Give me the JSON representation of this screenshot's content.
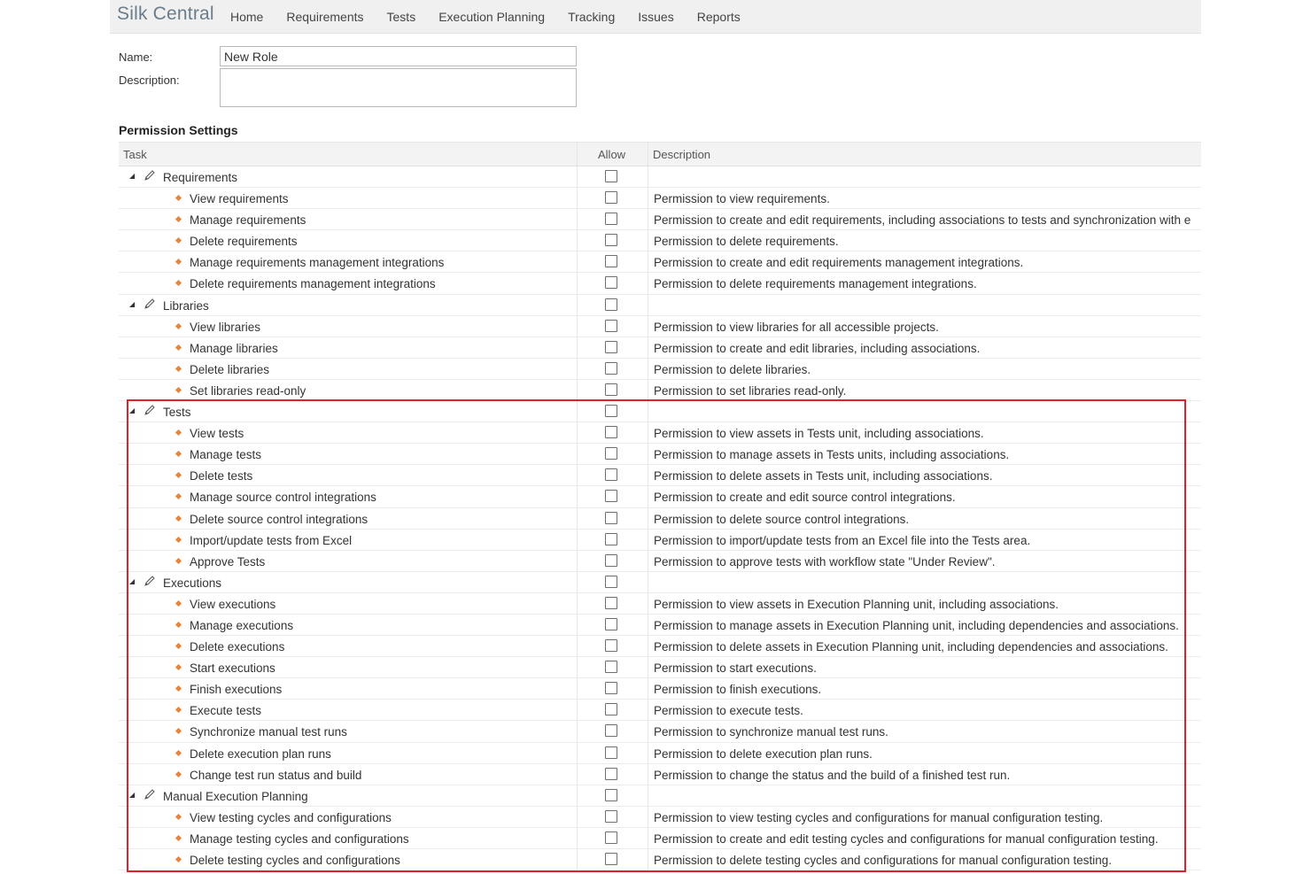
{
  "app": {
    "brand": "Silk Central",
    "nav": [
      "Home",
      "Requirements",
      "Tests",
      "Execution Planning",
      "Tracking",
      "Issues",
      "Reports"
    ]
  },
  "form": {
    "name_label": "Name:",
    "name_value": "New Role",
    "description_label": "Description:",
    "description_value": ""
  },
  "permissions": {
    "title": "Permission Settings",
    "columns": {
      "task": "Task",
      "allow": "Allow",
      "description": "Description"
    },
    "rows": [
      {
        "type": "group",
        "task": "Requirements",
        "desc": ""
      },
      {
        "type": "item",
        "task": "View requirements",
        "desc": "Permission to view requirements."
      },
      {
        "type": "item",
        "task": "Manage requirements",
        "desc": "Permission to create and edit requirements, including associations to tests and synchronization with e"
      },
      {
        "type": "item",
        "task": "Delete requirements",
        "desc": "Permission to delete requirements."
      },
      {
        "type": "item",
        "task": "Manage requirements management integrations",
        "desc": "Permission to create and edit requirements management integrations."
      },
      {
        "type": "item",
        "task": "Delete requirements management integrations",
        "desc": "Permission to delete requirements management integrations."
      },
      {
        "type": "group",
        "task": "Libraries",
        "desc": ""
      },
      {
        "type": "item",
        "task": "View libraries",
        "desc": "Permission to view libraries for all accessible projects."
      },
      {
        "type": "item",
        "task": "Manage libraries",
        "desc": "Permission to create and edit libraries, including associations."
      },
      {
        "type": "item",
        "task": "Delete libraries",
        "desc": "Permission to delete libraries."
      },
      {
        "type": "item",
        "task": "Set libraries read-only",
        "desc": "Permission to set libraries read-only."
      },
      {
        "type": "group",
        "task": "Tests",
        "desc": ""
      },
      {
        "type": "item",
        "task": "View tests",
        "desc": "Permission to view assets in Tests unit, including associations."
      },
      {
        "type": "item",
        "task": "Manage tests",
        "desc": "Permission to manage assets in Tests units, including associations."
      },
      {
        "type": "item",
        "task": "Delete tests",
        "desc": "Permission to delete assets in Tests unit, including associations."
      },
      {
        "type": "item",
        "task": "Manage source control integrations",
        "desc": "Permission to create and edit source control integrations."
      },
      {
        "type": "item",
        "task": "Delete source control integrations",
        "desc": "Permission to delete source control integrations."
      },
      {
        "type": "item",
        "task": "Import/update tests from Excel",
        "desc": "Permission to import/update tests from an Excel file into the Tests area."
      },
      {
        "type": "item",
        "task": "Approve Tests",
        "desc": "Permission to approve tests with workflow state \"Under Review\"."
      },
      {
        "type": "group",
        "task": "Executions",
        "desc": ""
      },
      {
        "type": "item",
        "task": "View executions",
        "desc": "Permission to view assets in Execution Planning unit, including associations."
      },
      {
        "type": "item",
        "task": "Manage executions",
        "desc": "Permission to manage assets in Execution Planning unit, including dependencies and associations."
      },
      {
        "type": "item",
        "task": "Delete executions",
        "desc": "Permission to delete assets in Execution Planning unit, including dependencies and associations."
      },
      {
        "type": "item",
        "task": "Start executions",
        "desc": "Permission to start executions."
      },
      {
        "type": "item",
        "task": "Finish executions",
        "desc": "Permission to finish executions."
      },
      {
        "type": "item",
        "task": "Execute tests",
        "desc": "Permission to execute tests."
      },
      {
        "type": "item",
        "task": "Synchronize manual test runs",
        "desc": "Permission to synchronize manual test runs."
      },
      {
        "type": "item",
        "task": "Delete execution plan runs",
        "desc": "Permission to delete execution plan runs."
      },
      {
        "type": "item",
        "task": "Change test run status and build",
        "desc": "Permission to change the status and the build of a finished test run."
      },
      {
        "type": "group",
        "task": "Manual Execution Planning",
        "desc": ""
      },
      {
        "type": "item",
        "task": "View testing cycles and configurations",
        "desc": "Permission to view testing cycles and configurations for manual configuration testing."
      },
      {
        "type": "item",
        "task": "Manage testing cycles and configurations",
        "desc": "Permission to create and edit testing cycles and configurations for manual configuration testing."
      },
      {
        "type": "item",
        "task": "Delete testing cycles and configurations",
        "desc": "Permission to delete testing cycles and configurations for manual configuration testing."
      }
    ]
  },
  "colors": {
    "highlight": "#e2202c",
    "bullet": "#e8843a",
    "brand": "#6b7c8a"
  }
}
